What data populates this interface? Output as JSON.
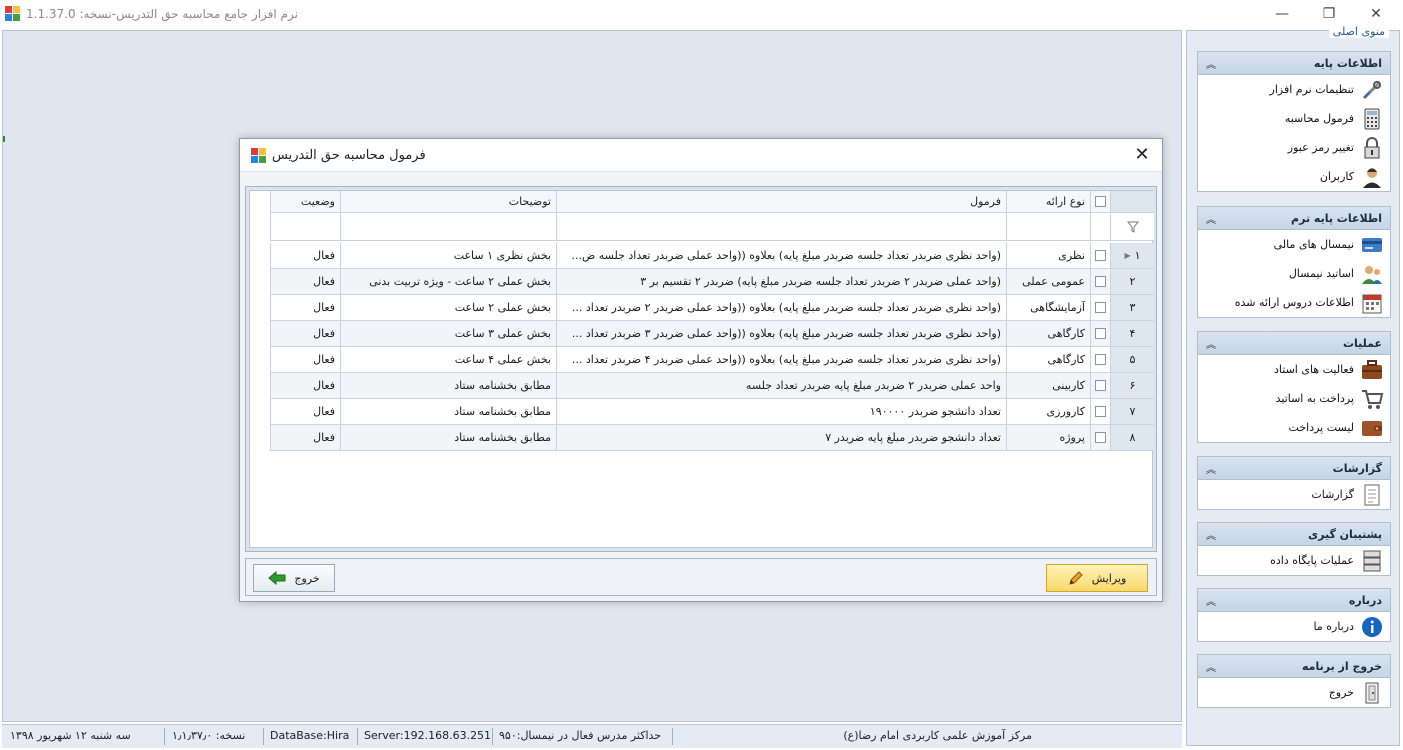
{
  "window": {
    "title": "نرم افزار جامع محاسبه حق التدریس-نسخه: 1.1.37.0",
    "minimize_glyph": "—",
    "maximize_glyph": "❐",
    "close_glyph": "✕"
  },
  "sidebar": {
    "caption": "منوی اصلی",
    "groups": [
      {
        "title": "اطلاعات پایه",
        "items": [
          {
            "label": "تنظیمات نرم افزار",
            "icon": "tools-icon"
          },
          {
            "label": "فرمول محاسبه",
            "icon": "calculator-icon"
          },
          {
            "label": "تغییر رمز عبور",
            "icon": "lock-icon"
          },
          {
            "label": "کاربران",
            "icon": "user-icon"
          }
        ]
      },
      {
        "title": "اطلاعات پایه ترم",
        "items": [
          {
            "label": "نیمسال های مالی",
            "icon": "card-icon"
          },
          {
            "label": "اساتید نیمسال",
            "icon": "teachers-icon"
          },
          {
            "label": "اطلاعات دروس ارائه شده",
            "icon": "calendar-icon"
          }
        ]
      },
      {
        "title": "عملیات",
        "items": [
          {
            "label": "فعالیت های استاد",
            "icon": "briefcase-icon"
          },
          {
            "label": "پرداخت به اساتید",
            "icon": "cart-icon"
          },
          {
            "label": "لیست پرداخت",
            "icon": "wallet-icon"
          }
        ]
      },
      {
        "title": "گزارشات",
        "items": [
          {
            "label": "گزارشات",
            "icon": "report-icon"
          }
        ]
      },
      {
        "title": "پشتیبان گیری",
        "items": [
          {
            "label": "عملیات پایگاه داده",
            "icon": "database-icon"
          }
        ]
      },
      {
        "title": "درباره",
        "items": [
          {
            "label": "درباره ما",
            "icon": "info-icon"
          }
        ]
      },
      {
        "title": "خروج از برنامه",
        "items": [
          {
            "label": "خروج",
            "icon": "exit-door-icon"
          }
        ]
      }
    ]
  },
  "dialog": {
    "title": "فرمول محاسبه حق التدریس",
    "close_glyph": "✕",
    "columns": {
      "type": "نوع ارائه",
      "formula": "فرمول",
      "description": "توضیحات",
      "status": "وضعیت"
    },
    "rows": [
      {
        "num": "۱",
        "type": "نظری",
        "formula": "(واحد نظری ضربدر تعداد جلسه ضربدر مبلغ پایه) بعلاوه ((واحد عملی ضربدر تعداد جلسه ض...",
        "description": "بخش نظری ۱ ساعت",
        "status": "فعال"
      },
      {
        "num": "۲",
        "type": "عمومی عملی",
        "formula": "(واحد عملی ضربدر ۲ ضربدر تعداد جلسه ضربدر مبلغ پایه) ضربدر ۲ تقسیم بر ۳",
        "description": "بخش عملی ۲ ساعت - ویژه تربیت بدنی",
        "status": "فعال"
      },
      {
        "num": "۳",
        "type": "آزمایشگاهی",
        "formula": "(واحد نظری ضربدر تعداد جلسه ضربدر مبلغ پایه) بعلاوه ((واحد عملی ضربدر ۲ ضربدر تعداد ...",
        "description": "بخش عملی ۲ ساعت",
        "status": "فعال"
      },
      {
        "num": "۴",
        "type": "کارگاهی",
        "formula": "(واحد نظری ضربدر تعداد جلسه ضربدر مبلغ پایه) بعلاوه ((واحد عملی ضربدر ۳ ضربدر تعداد ...",
        "description": "بخش عملی ۳ ساعت",
        "status": "فعال"
      },
      {
        "num": "۵",
        "type": "کارگاهی",
        "formula": "(واحد نظری ضربدر تعداد جلسه ضربدر مبلغ پایه) بعلاوه ((واحد عملی ضربدر ۴ ضربدر تعداد ...",
        "description": "بخش عملی ۴ ساعت",
        "status": "فعال"
      },
      {
        "num": "۶",
        "type": "کاربینی",
        "formula": "واحد عملی ضربدر ۲ ضربدر مبلغ پایه ضربدر تعداد جلسه",
        "description": "مطابق بخشنامه ستاد",
        "status": "فعال"
      },
      {
        "num": "۷",
        "type": "کارورزی",
        "formula": "تعداد دانشجو ضربدر ۱۹۰۰۰۰",
        "description": "مطابق بخشنامه ستاد",
        "status": "فعال"
      },
      {
        "num": "۸",
        "type": "پروژه",
        "formula": "تعداد دانشجو ضربدر مبلغ پایه ضربدر ۷",
        "description": "مطابق بخشنامه ستاد",
        "status": "فعال"
      }
    ],
    "edit_button": "ویرایش",
    "exit_button": "خروج"
  },
  "statusbar": {
    "institute": "مرکز آموزش علمی کاربردی امام رضا(ع)",
    "max_teachers": "حداکثر مدرس فعال در نیمسال:۹۵۰",
    "server": "Server:192.168.63.251",
    "database": "DataBase:Hira",
    "version": "نسخه: ۱٫۱٫۳۷٫۰",
    "date": "سه شنبه ۱۲ شهریور ۱۳۹۸"
  }
}
